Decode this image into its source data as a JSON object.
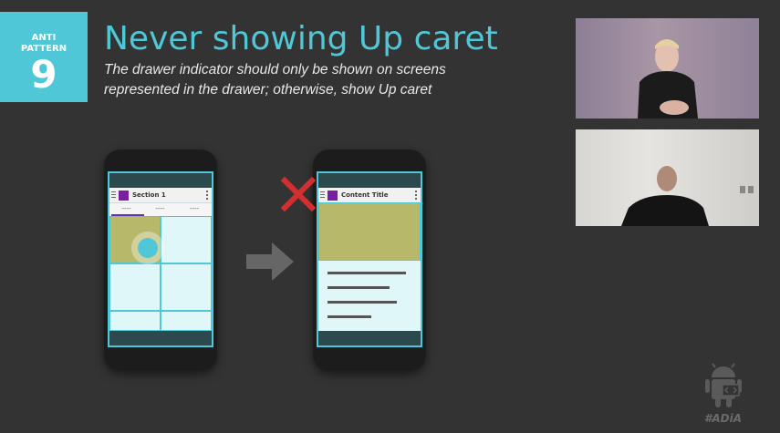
{
  "slide": {
    "badge": {
      "line1": "ANTI",
      "line2": "PATTERN",
      "number": "9"
    },
    "title": "Never showing Up caret",
    "subtitle": "The drawer indicator should only be shown on screens represented in the drawer; otherwise, show Up caret",
    "hashtag": "#ADiA"
  },
  "phone_left": {
    "action_bar_title": "Section 1",
    "tabs": [
      "----",
      "----",
      "----"
    ]
  },
  "phone_right": {
    "action_bar_title": "Content Title"
  },
  "colors": {
    "accent": "#4fc7d6",
    "background": "#333333",
    "purple": "#7b1fa2",
    "error_x": "#d32f2f",
    "olive": "#b8b86a"
  },
  "icons": {
    "transition": "right-arrow-icon",
    "wrong": "red-x-icon",
    "logo": "android-logo-icon"
  }
}
